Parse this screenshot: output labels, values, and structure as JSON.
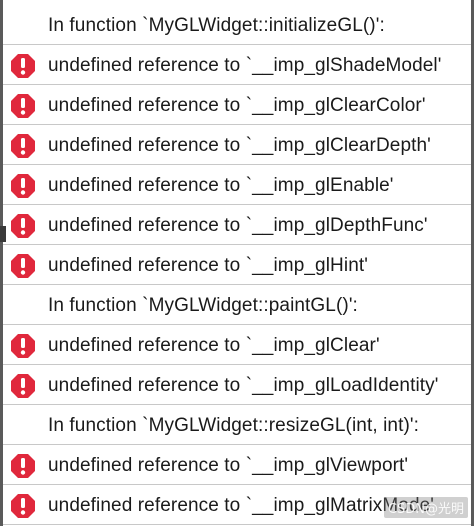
{
  "issues": [
    {
      "kind": "context",
      "text": "In function `MyGLWidget::initializeGL()':"
    },
    {
      "kind": "error",
      "icon": "error-icon",
      "text": "undefined reference to `__imp_glShadeModel'"
    },
    {
      "kind": "error",
      "icon": "error-icon",
      "text": "undefined reference to `__imp_glClearColor'"
    },
    {
      "kind": "error",
      "icon": "error-icon",
      "text": "undefined reference to `__imp_glClearDepth'"
    },
    {
      "kind": "error",
      "icon": "error-icon",
      "text": "undefined reference to `__imp_glEnable'"
    },
    {
      "kind": "error",
      "icon": "error-icon",
      "text": "undefined reference to `__imp_glDepthFunc'"
    },
    {
      "kind": "error",
      "icon": "error-icon",
      "text": "undefined reference to `__imp_glHint'"
    },
    {
      "kind": "context",
      "text": "In function `MyGLWidget::paintGL()':"
    },
    {
      "kind": "error",
      "icon": "error-icon",
      "text": "undefined reference to `__imp_glClear'"
    },
    {
      "kind": "error",
      "icon": "error-icon",
      "text": "undefined reference to `__imp_glLoadIdentity'"
    },
    {
      "kind": "context",
      "text": "In function `MyGLWidget::resizeGL(int, int)':"
    },
    {
      "kind": "error",
      "icon": "error-icon",
      "text": "undefined reference to `__imp_glViewport'"
    },
    {
      "kind": "error",
      "icon": "error-icon",
      "text": "undefined reference to `__imp_glMatrixMode'"
    }
  ],
  "colors": {
    "error_icon": "#e0283c",
    "text": "#1a1a1a",
    "divider": "#c8c8c8"
  },
  "watermark": "CSDN@光明"
}
